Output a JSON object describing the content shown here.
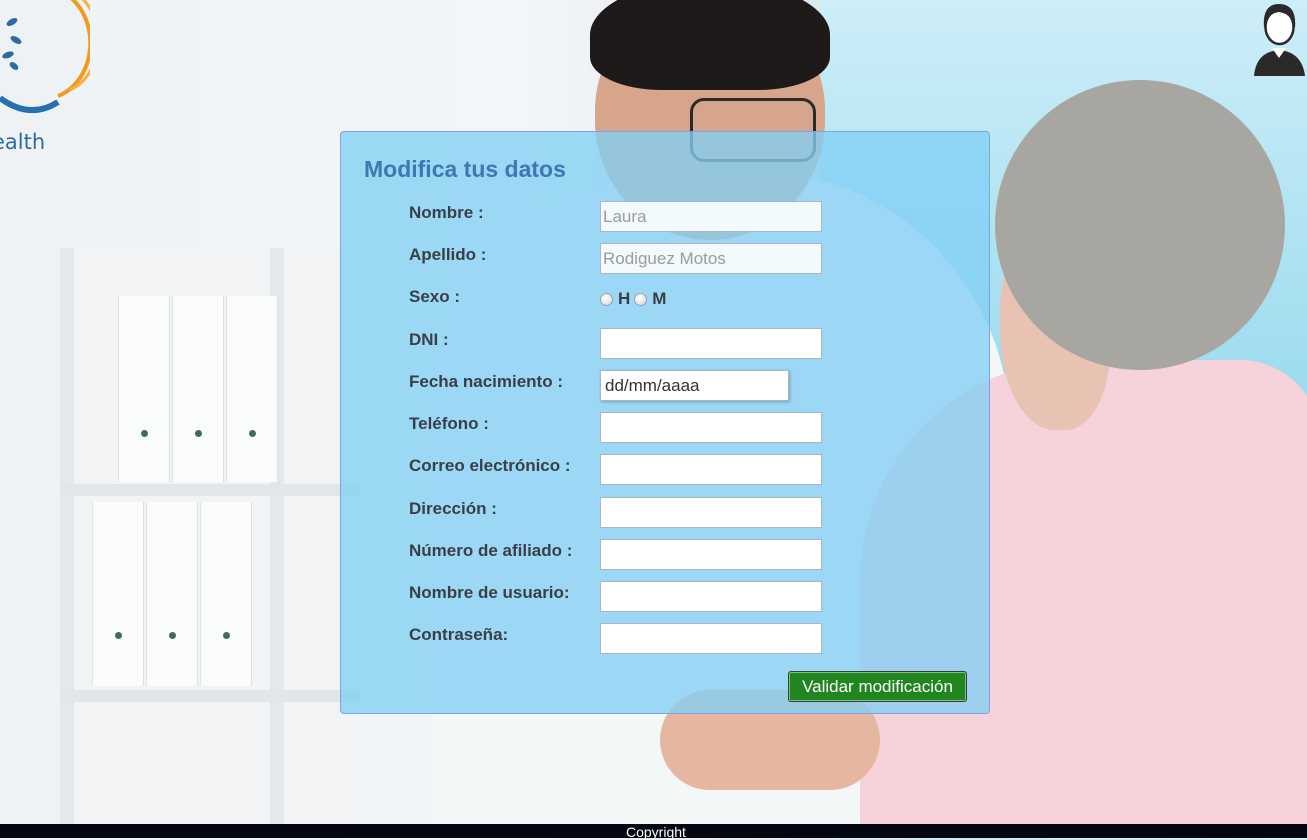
{
  "brand": {
    "logo_text": "ealth"
  },
  "user": {
    "avatar_icon": "user-avatar-icon"
  },
  "form": {
    "title": "Modifica tus datos",
    "fields": {
      "nombre": {
        "label": "Nombre :",
        "value": "Laura"
      },
      "apellido": {
        "label": "Apellido :",
        "value": "Rodiguez Motos"
      },
      "sexo": {
        "label": "Sexo :",
        "options": [
          "H",
          "M"
        ]
      },
      "dni": {
        "label": "DNI :",
        "value": ""
      },
      "fecha": {
        "label": "Fecha nacimiento :",
        "placeholder": "dd/mm/aaaa"
      },
      "telefono": {
        "label": "Teléfono :",
        "value": ""
      },
      "correo": {
        "label": "Correo electrónico :",
        "value": ""
      },
      "direccion": {
        "label": "Dirección :",
        "value": ""
      },
      "afiliado": {
        "label": "Número de afiliado :",
        "value": ""
      },
      "usuario": {
        "label": "Nombre de usuario:",
        "value": ""
      },
      "contrasena": {
        "label": "Contraseña:",
        "value": ""
      }
    },
    "submit_label": "Validar modificación"
  },
  "footer": {
    "text": "Copyright"
  },
  "colors": {
    "panel": "#83cff4",
    "title": "#3f77b5",
    "submit": "#21861f",
    "footer": "#050611"
  }
}
